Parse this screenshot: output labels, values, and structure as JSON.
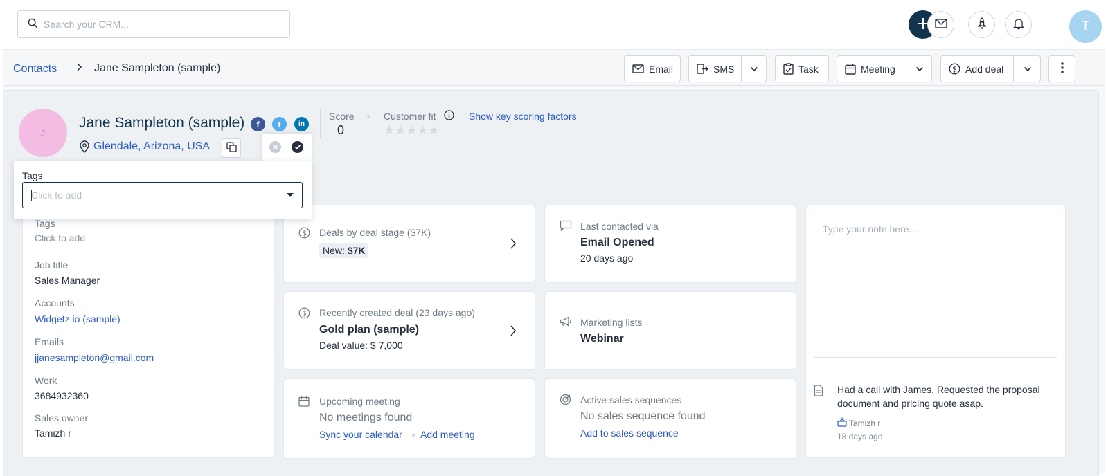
{
  "search": {
    "placeholder": "Search your CRM..."
  },
  "user_avatar_initial": "T",
  "breadcrumb": {
    "parent": "Contacts",
    "current": "Jane Sampleton (sample)"
  },
  "actions": {
    "email": "Email",
    "sms": "SMS",
    "task": "Task",
    "meeting": "Meeting",
    "add_deal": "Add deal"
  },
  "contact": {
    "initial": "J",
    "name": "Jane Sampleton (sample)",
    "location": "Glendale, Arizona, USA",
    "score_label": "Score",
    "score": "0",
    "fit_label": "Customer fit",
    "stars": "★★★★★",
    "key_factors": "Show key scoring factors"
  },
  "social": {
    "facebook": "f",
    "twitter": "t",
    "linkedin": "in"
  },
  "tags_popover": {
    "label": "Tags",
    "placeholder": "Click to add"
  },
  "details": {
    "tags_label": "Tags",
    "tags_value": "Click to add",
    "job_title_label": "Job title",
    "job_title": "Sales Manager",
    "accounts_label": "Accounts",
    "account": "Widgetz.io (sample)",
    "emails_label": "Emails",
    "email": "jjanesampleton@gmail.com",
    "work_label": "Work",
    "work": "3684932360",
    "owner_label": "Sales owner",
    "owner": "Tamizh r"
  },
  "cards": {
    "deals_stage_title": "Deals by deal stage ($7K)",
    "deals_stage_badge_label": "New: ",
    "deals_stage_badge_value": "$7K",
    "recent_deal_title": "Recently created deal (23 days ago)",
    "recent_deal_name": "Gold plan (sample)",
    "recent_deal_value": "Deal value: $ 7,000",
    "meeting_title": "Upcoming meeting",
    "meeting_empty": "No meetings found",
    "meeting_sync": "Sync your calendar",
    "meeting_add": "Add meeting",
    "last_contacted_title": "Last contacted via",
    "last_contacted_value": "Email Opened",
    "last_contacted_time": "20 days ago",
    "marketing_title": "Marketing lists",
    "marketing_value": "Webinar",
    "sequences_title": "Active sales sequences",
    "sequences_empty": "No sales sequence found",
    "sequences_add": "Add to sales sequence"
  },
  "notes": {
    "placeholder": "Type your note here...",
    "text": "Had a call with James. Requested the proposal document and pricing quote asap.",
    "author": "Tamizh r",
    "time": "18 days ago"
  },
  "colors": {
    "accent": "#2c5cc5",
    "primary_dark": "#12344d",
    "facebook": "#3b5998",
    "twitter": "#55acee",
    "linkedin": "#0077b5",
    "avatar_pink": "#f3bde3",
    "avatar_blue": "#a6d5f1"
  }
}
